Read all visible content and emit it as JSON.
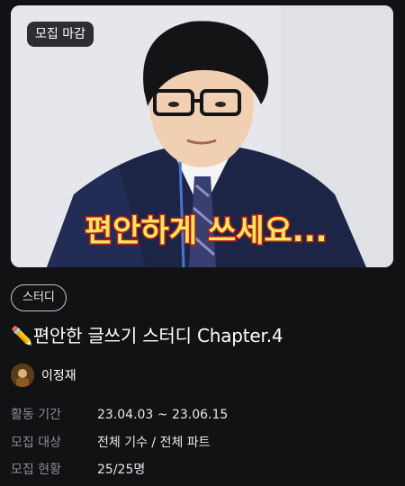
{
  "thumbnail": {
    "recruit_status_badge": "모집 마감",
    "caption_text": "편안하게 쓰세요..."
  },
  "category_chip": "스터디",
  "title": "✏️편안한 글쓰기 스터디 Chapter.4",
  "author": {
    "name": "이정재"
  },
  "info": [
    {
      "label": "활동 기간",
      "value": "23.04.03 ~ 23.06.15"
    },
    {
      "label": "모집 대상",
      "value": "전체 기수 / 전체 파트"
    },
    {
      "label": "모집 현황",
      "value": "25/25명"
    }
  ]
}
